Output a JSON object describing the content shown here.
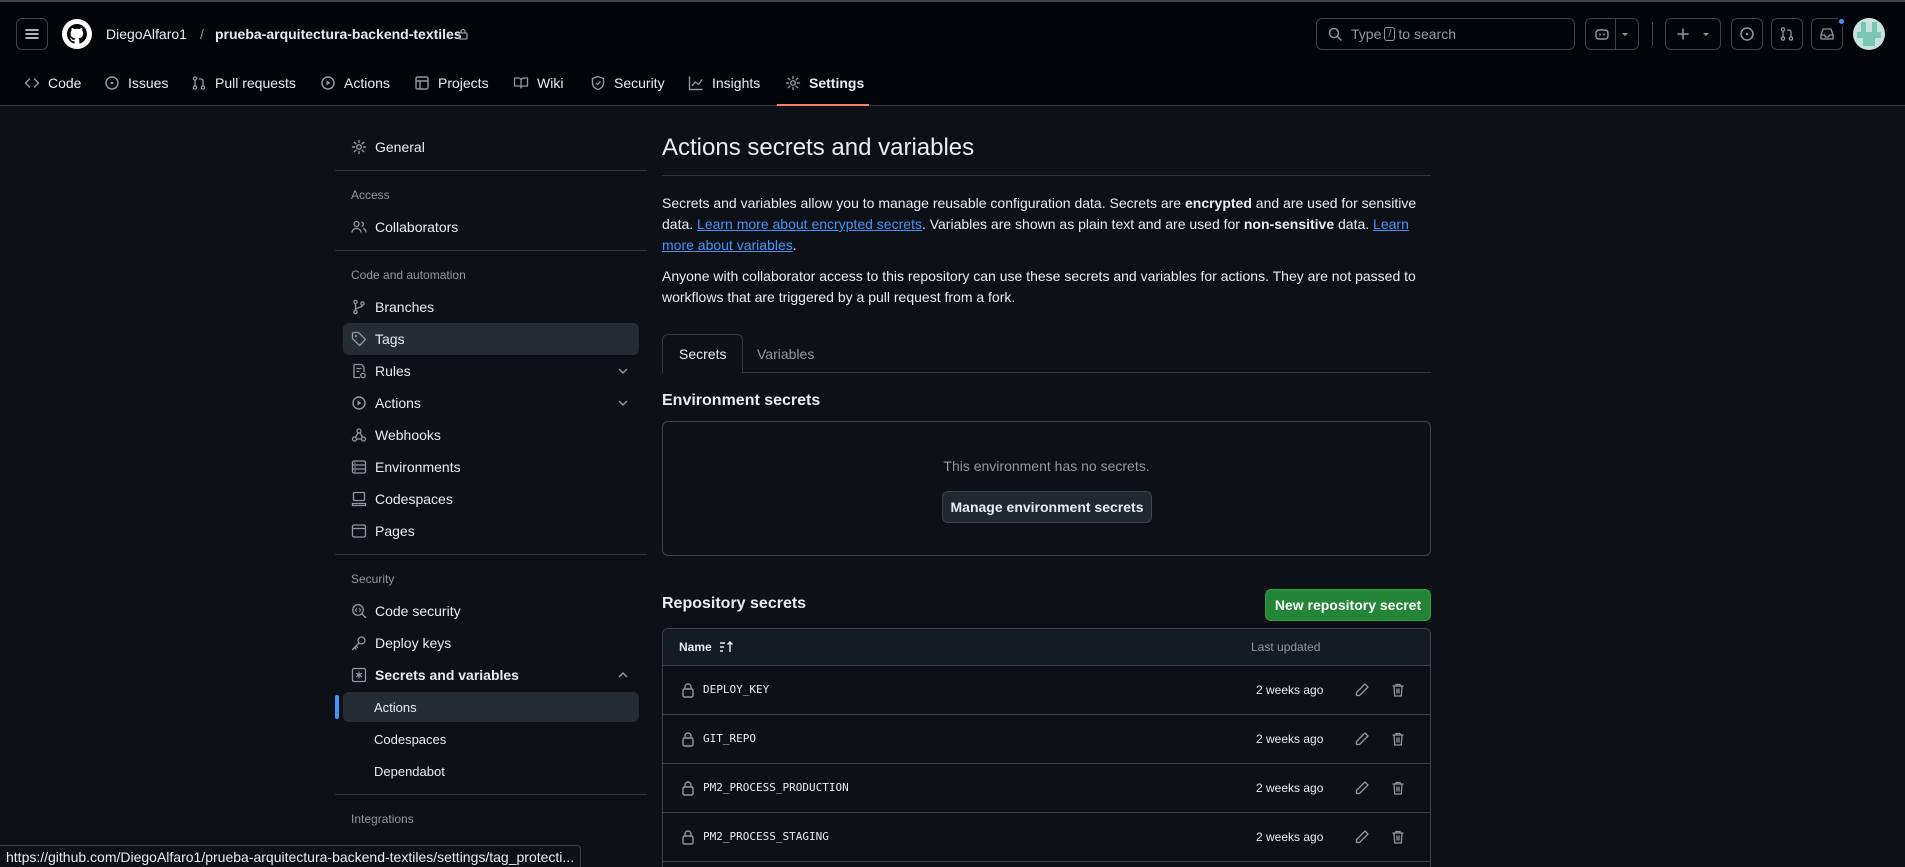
{
  "header": {
    "owner": "DiegoAlfaro1",
    "separator": "/",
    "repo": "prueba-arquitectura-backend-textiles",
    "search": {
      "prefix": "Type",
      "key": "/",
      "suffix": "to search"
    }
  },
  "repo_tabs": [
    {
      "label": "Code",
      "icon": "code-icon"
    },
    {
      "label": "Issues",
      "icon": "issue-icon"
    },
    {
      "label": "Pull requests",
      "icon": "pull-request-icon"
    },
    {
      "label": "Actions",
      "icon": "play-icon"
    },
    {
      "label": "Projects",
      "icon": "table-icon"
    },
    {
      "label": "Wiki",
      "icon": "book-icon"
    },
    {
      "label": "Security",
      "icon": "shield-icon"
    },
    {
      "label": "Insights",
      "icon": "graph-icon"
    },
    {
      "label": "Settings",
      "icon": "gear-icon",
      "active": true
    }
  ],
  "sidebar": {
    "general": "General",
    "access_heading": "Access",
    "collaborators": "Collaborators",
    "code_heading": "Code and automation",
    "branches": "Branches",
    "tags": "Tags",
    "rules": "Rules",
    "actions": "Actions",
    "webhooks": "Webhooks",
    "environments": "Environments",
    "codespaces": "Codespaces",
    "pages": "Pages",
    "security_heading": "Security",
    "code_security": "Code security",
    "deploy_keys": "Deploy keys",
    "secrets_vars": "Secrets and variables",
    "sub_actions": "Actions",
    "sub_codespaces": "Codespaces",
    "sub_dependabot": "Dependabot",
    "integrations_heading": "Integrations"
  },
  "main": {
    "title": "Actions secrets and variables",
    "p1": {
      "t1": "Secrets and variables allow you to manage reusable configuration data. Secrets are ",
      "b1": "encrypted",
      "t2": " and are used for sensitive data. ",
      "link1": "Learn more about encrypted secrets",
      "t3": ". Variables are shown as plain text and are used for ",
      "b2": "non-sensitive",
      "t4": " data. ",
      "link2": "Learn more about variables",
      "t5": "."
    },
    "p2": "Anyone with collaborator access to this repository can use these secrets and variables for actions. They are not passed to workflows that are triggered by a pull request from a fork.",
    "tab_secrets": "Secrets",
    "tab_variables": "Variables",
    "env_heading": "Environment secrets",
    "env_empty": "This environment has no secrets.",
    "env_button": "Manage environment secrets",
    "repo_heading": "Repository secrets",
    "new_button": "New repository secret",
    "col_name": "Name",
    "col_updated": "Last updated",
    "secrets": [
      {
        "name": "DEPLOY_KEY",
        "updated": "2 weeks ago"
      },
      {
        "name": "GIT_REPO",
        "updated": "2 weeks ago"
      },
      {
        "name": "PM2_PROCESS_PRODUCTION",
        "updated": "2 weeks ago"
      },
      {
        "name": "PM2_PROCESS_STAGING",
        "updated": "2 weeks ago"
      }
    ]
  },
  "status_url": "https://github.com/DiegoAlfaro1/prueba-arquitectura-backend-textiles/settings/tag_protecti..."
}
